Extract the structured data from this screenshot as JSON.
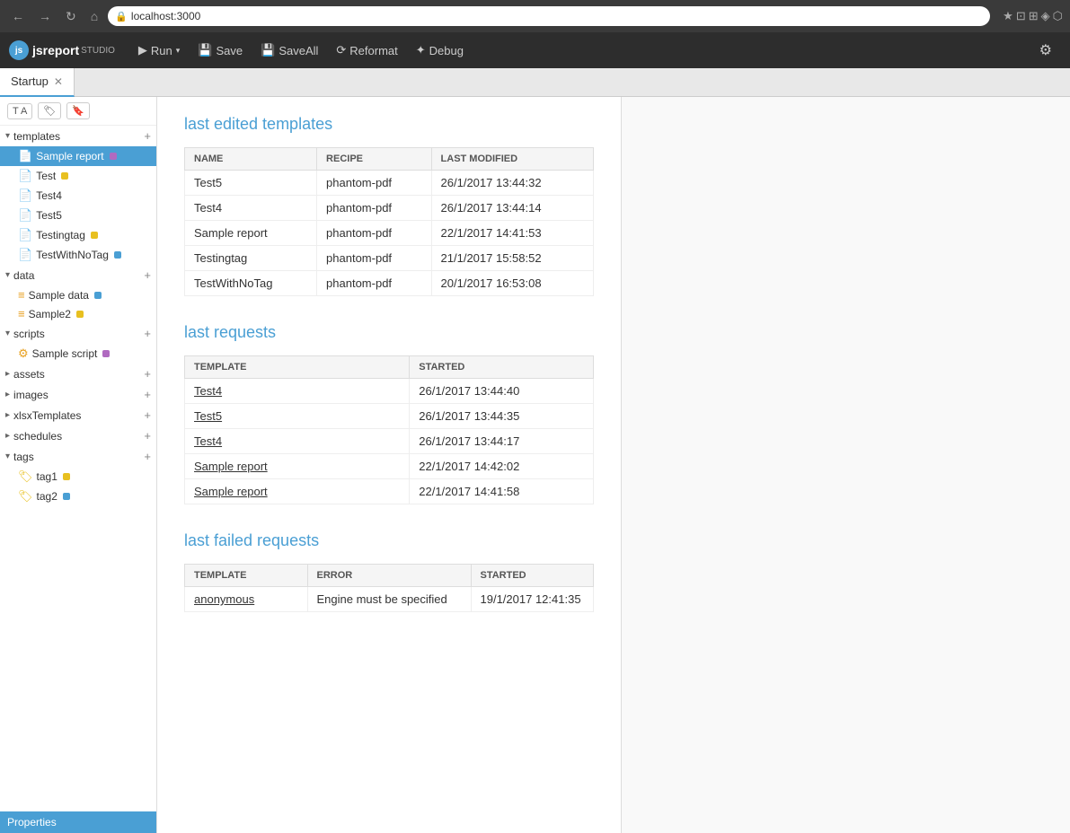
{
  "browser": {
    "address": "localhost:3000",
    "lock_icon": "🔒"
  },
  "app": {
    "logo_text": "jsreport",
    "logo_studio": "STUDIO",
    "toolbar": {
      "run_label": "▶ Run",
      "save_label": "💾 Save",
      "saveall_label": "💾 SaveAll",
      "reformat_label": "⟳ Reformat",
      "debug_label": "✦ Debug"
    }
  },
  "tabs": [
    {
      "label": "Startup",
      "active": true,
      "closeable": true
    }
  ],
  "sidebar": {
    "tools": [
      {
        "label": "T A",
        "name": "font-size-tool"
      },
      {
        "label": "🏷",
        "name": "tag-filter-tool"
      },
      {
        "label": "🔖",
        "name": "tag-tool"
      }
    ],
    "sections": [
      {
        "name": "templates",
        "label": "templates",
        "expanded": true,
        "items": [
          {
            "label": "Sample report",
            "selected": true,
            "tag": "purple",
            "icon": "doc"
          },
          {
            "label": "Test",
            "tag": "yellow",
            "icon": "doc"
          },
          {
            "label": "Test4",
            "icon": "doc"
          },
          {
            "label": "Test5",
            "icon": "doc"
          },
          {
            "label": "Testingtag",
            "tag": "yellow",
            "icon": "doc"
          },
          {
            "label": "TestWithNoTag",
            "tag": "blue",
            "icon": "doc"
          }
        ]
      },
      {
        "name": "data",
        "label": "data",
        "expanded": true,
        "items": [
          {
            "label": "Sample data",
            "tag": "blue",
            "icon": "db"
          },
          {
            "label": "Sample2",
            "tag": "yellow",
            "icon": "db"
          }
        ]
      },
      {
        "name": "scripts",
        "label": "scripts",
        "expanded": true,
        "items": [
          {
            "label": "Sample script",
            "tag": "purple",
            "icon": "gear"
          }
        ]
      },
      {
        "name": "assets",
        "label": "assets",
        "expanded": false,
        "items": []
      },
      {
        "name": "images",
        "label": "images",
        "expanded": false,
        "items": []
      },
      {
        "name": "xlsxTemplates",
        "label": "xlsxTemplates",
        "expanded": false,
        "items": []
      },
      {
        "name": "schedules",
        "label": "schedules",
        "expanded": false,
        "items": []
      },
      {
        "name": "tags",
        "label": "tags",
        "expanded": true,
        "items": [
          {
            "label": "tag1",
            "tag": "yellow",
            "icon": "tag"
          },
          {
            "label": "tag2",
            "tag": "blue",
            "icon": "tag"
          }
        ]
      }
    ],
    "properties_label": "Properties"
  },
  "main": {
    "last_edited": {
      "title": "last edited templates",
      "columns": [
        "NAME",
        "RECIPE",
        "LAST MODIFIED"
      ],
      "rows": [
        {
          "name": "Test5",
          "recipe": "phantom-pdf",
          "modified": "26/1/2017 13:44:32"
        },
        {
          "name": "Test4",
          "recipe": "phantom-pdf",
          "modified": "26/1/2017 13:44:14"
        },
        {
          "name": "Sample report",
          "recipe": "phantom-pdf",
          "modified": "22/1/2017 14:41:53"
        },
        {
          "name": "Testingtag",
          "recipe": "phantom-pdf",
          "modified": "21/1/2017 15:58:52"
        },
        {
          "name": "TestWithNoTag",
          "recipe": "phantom-pdf",
          "modified": "20/1/2017 16:53:08"
        }
      ]
    },
    "last_requests": {
      "title": "last requests",
      "columns": [
        "TEMPLATE",
        "STARTED"
      ],
      "rows": [
        {
          "template": "Test4",
          "started": "26/1/2017 13:44:40"
        },
        {
          "template": "Test5",
          "started": "26/1/2017 13:44:35"
        },
        {
          "template": "Test4",
          "started": "26/1/2017 13:44:17"
        },
        {
          "template": "Sample report",
          "started": "22/1/2017 14:42:02"
        },
        {
          "template": "Sample report",
          "started": "22/1/2017 14:41:58"
        }
      ]
    },
    "last_failed": {
      "title": "last failed requests",
      "columns": [
        "TEMPLATE",
        "ERROR",
        "STARTED"
      ],
      "rows": [
        {
          "template": "anonymous",
          "error": "Engine must be specified",
          "started": "19/1/2017 12:41:35"
        }
      ]
    }
  }
}
